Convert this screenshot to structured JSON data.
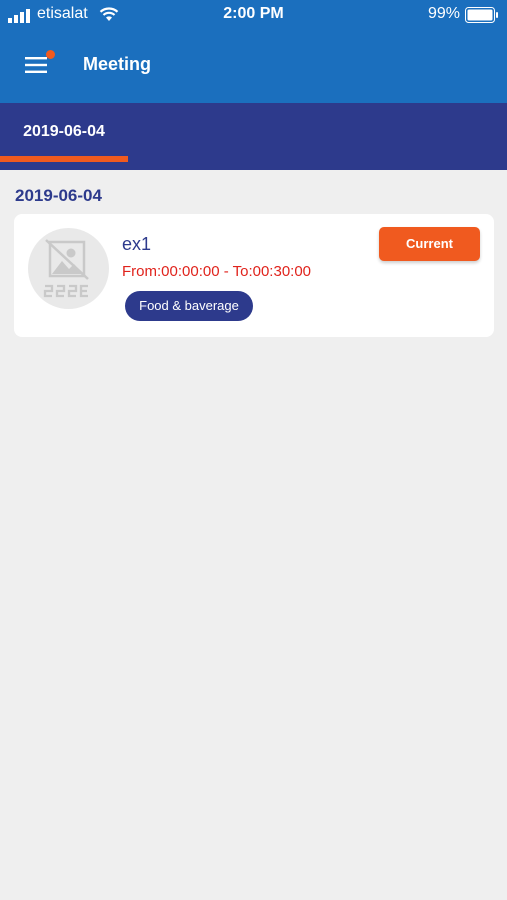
{
  "status_bar": {
    "carrier": "etisalat",
    "time": "2:00 PM",
    "battery": "99%"
  },
  "app_bar": {
    "title": "Meeting",
    "menu_icon": "hamburger-menu-icon",
    "has_notification": true
  },
  "tabs": [
    {
      "label": "2019-06-04",
      "selected": true
    }
  ],
  "section": {
    "date": "2019-06-04"
  },
  "meetings": [
    {
      "title": "ex1",
      "time": "From:00:00:00 - To:00:30:00",
      "category": "Food & baverage",
      "status": "Current",
      "thumbnail_icon": "image-placeholder-icon"
    }
  ],
  "colors": {
    "app_bar": "#1b6fbe",
    "tab_bar": "#2d3a8c",
    "accent": "#f05a1f",
    "time_text": "#e0231c",
    "background": "#efefef"
  }
}
